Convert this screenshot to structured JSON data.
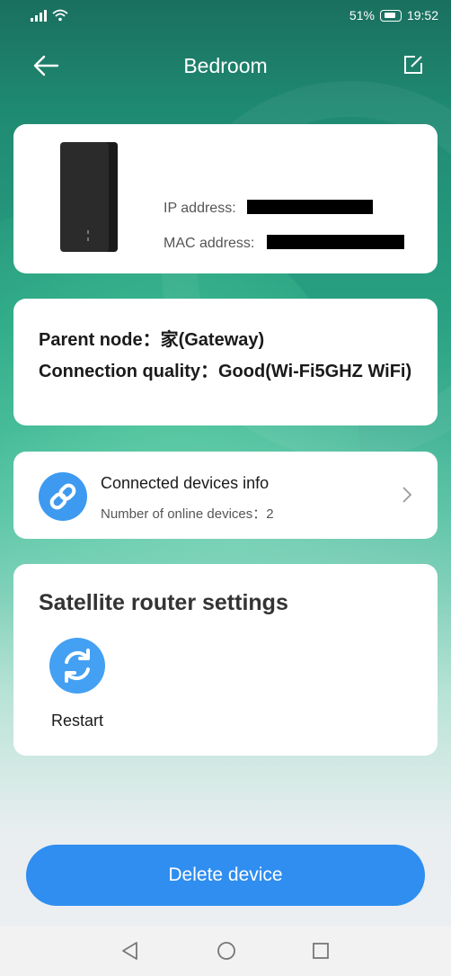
{
  "status_bar": {
    "battery_percent": "51%",
    "time": "19:52"
  },
  "header": {
    "title": "Bedroom",
    "back_icon": "arrow-left-icon",
    "edit_icon": "edit-icon"
  },
  "device": {
    "ip_label": "IP address:",
    "mac_label": "MAC address:"
  },
  "node": {
    "parent_node": "Parent node：家(Gateway)",
    "connection_quality": "Connection quality：Good(Wi-Fi5GHZ WiFi)"
  },
  "connected_devices": {
    "title": "Connected devices info",
    "subtitle": "Number of online devices：2",
    "icon": "link-icon"
  },
  "settings": {
    "title": "Satellite router settings",
    "restart_label": "Restart",
    "restart_icon": "refresh-icon"
  },
  "actions": {
    "delete_label": "Delete device"
  },
  "colors": {
    "accent_blue": "#2f8ef0",
    "header_green": "#1f8a72"
  }
}
